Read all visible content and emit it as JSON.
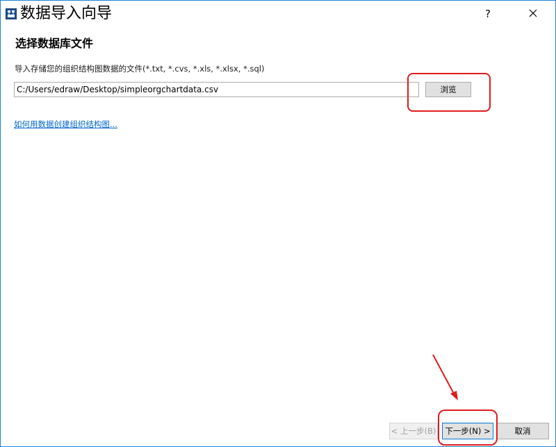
{
  "window": {
    "title": "数据导入向导",
    "help_label": "?",
    "icon": "app-icon",
    "close_icon": "close-icon"
  },
  "page": {
    "section_title": "选择数据库文件",
    "description": "导入存储您的组织结构图数据的文件(*.txt, *.cvs, *.xls, *.xlsx, *.sql)",
    "file_path": "C:/Users/edraw/Desktop/simpleorgchartdata.csv",
    "browse_label": "浏览",
    "help_link": "如何用数据创建组织结构图..."
  },
  "footer": {
    "prev_label": "< 上一步(B)",
    "next_label": "下一步(N) >",
    "cancel_label": "取消"
  },
  "annotations": {
    "highlight_color": "#e01b1b",
    "arrow_color": "#e01b1b"
  }
}
